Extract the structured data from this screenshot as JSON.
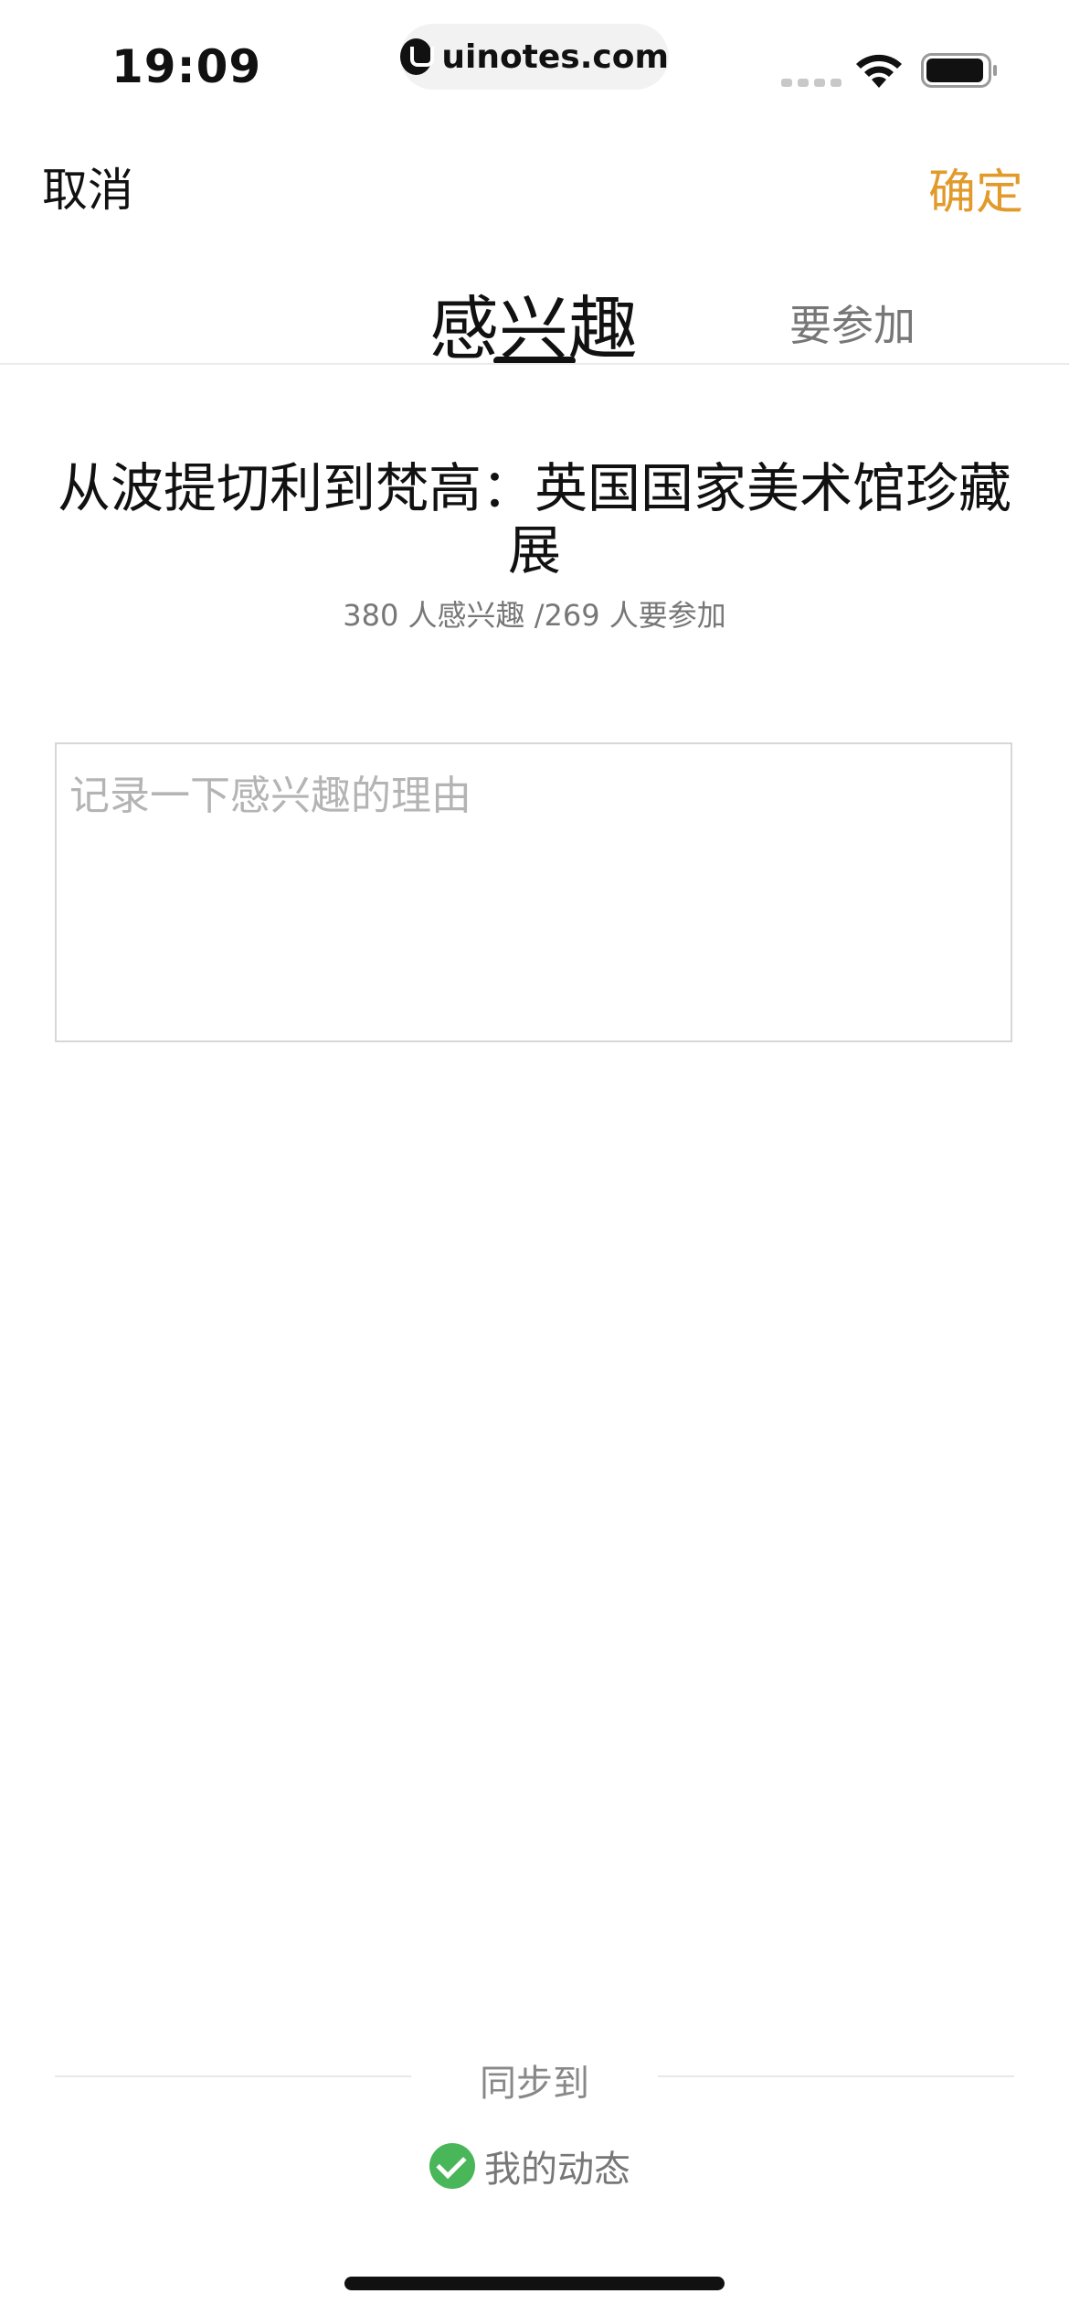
{
  "status_bar": {
    "time": "19:09",
    "url": "uinotes.com"
  },
  "nav": {
    "cancel_label": "取消",
    "confirm_label": "确定"
  },
  "tabs": [
    {
      "label": "感兴趣",
      "active": true
    },
    {
      "label": "要参加",
      "active": false
    }
  ],
  "event": {
    "title": "从波提切利到梵高：英国国家美术馆珍藏展",
    "stats": "380 人感兴趣 /269 人要参加"
  },
  "reason_input": {
    "placeholder": "记录一下感兴趣的理由",
    "value": ""
  },
  "sync": {
    "label": "同步到",
    "option_label": "我的动态",
    "option_checked": true
  },
  "colors": {
    "accent": "#e29a2b",
    "check": "#49b65a"
  }
}
